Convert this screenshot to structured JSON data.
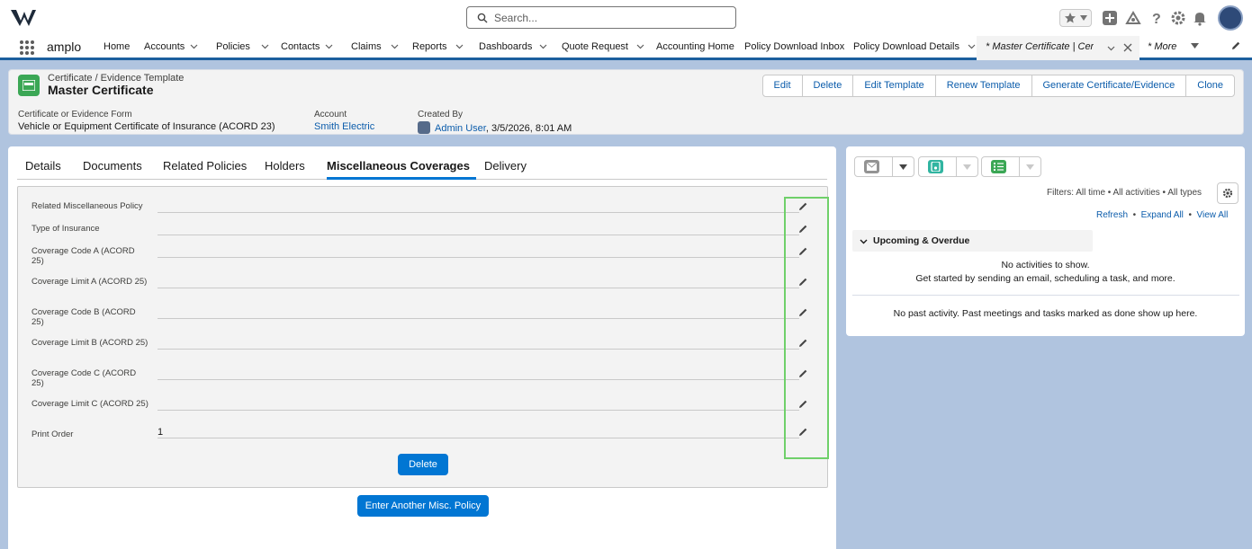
{
  "header": {
    "search_placeholder": "Search...",
    "app_name": "amplo"
  },
  "nav": {
    "items": [
      {
        "label": "Home"
      },
      {
        "label": "Accounts"
      },
      {
        "label": "Policies"
      },
      {
        "label": "Contacts"
      },
      {
        "label": "Claims"
      },
      {
        "label": "Reports"
      },
      {
        "label": "Dashboards"
      },
      {
        "label": "Quote Request"
      },
      {
        "label": "Accounting Home"
      },
      {
        "label": "Policy Download Inbox"
      },
      {
        "label": "Policy Download Details"
      }
    ],
    "active_tab": "* Master Certificate | Cert...",
    "more": "* More"
  },
  "record": {
    "object_type": "Certificate / Evidence Template",
    "title": "Master Certificate",
    "actions": [
      "Edit",
      "Delete",
      "Edit Template",
      "Renew Template",
      "Generate Certificate/Evidence",
      "Clone"
    ],
    "highlights": {
      "form_label": "Certificate or Evidence Form",
      "form_value": "Vehicle or Equipment Certificate of Insurance (ACORD 23)",
      "account_label": "Account",
      "account_value": "Smith Electric",
      "created_label": "Created By",
      "created_user": "Admin User",
      "created_date": ", 3/5/2026, 8:01 AM"
    }
  },
  "tabs": [
    "Details",
    "Documents",
    "Related Policies",
    "Holders",
    "Miscellaneous Coverages",
    "Delivery"
  ],
  "coverage": {
    "fields": [
      {
        "label": "Related Miscellaneous Policy",
        "value": ""
      },
      {
        "label": "Type of Insurance",
        "value": ""
      },
      {
        "label": "Coverage Code A (ACORD 25)",
        "value": ""
      },
      {
        "label": "Coverage Limit A (ACORD 25)",
        "value": ""
      },
      {
        "label": "Coverage Code B (ACORD 25)",
        "value": ""
      },
      {
        "label": "Coverage Limit B (ACORD 25)",
        "value": ""
      },
      {
        "label": "Coverage Code C (ACORD 25)",
        "value": ""
      },
      {
        "label": "Coverage Limit C (ACORD 25)",
        "value": ""
      },
      {
        "label": "Print Order",
        "value": "1"
      }
    ],
    "delete_label": "Delete",
    "enter_another_label": "Enter Another Misc. Policy"
  },
  "activity": {
    "filters": "Filters: All time • All activities • All types",
    "refresh": "Refresh",
    "expand_all": "Expand All",
    "view_all": "View All",
    "upcoming": "Upcoming & Overdue",
    "no_activities": "No activities to show.",
    "get_started": "Get started by sending an email, scheduling a task, and more.",
    "no_past": "No past activity. Past meetings and tasks marked as done show up here.",
    "colors": {
      "email": "#939393",
      "call": "#31b5a1",
      "task": "#3ba755"
    }
  }
}
